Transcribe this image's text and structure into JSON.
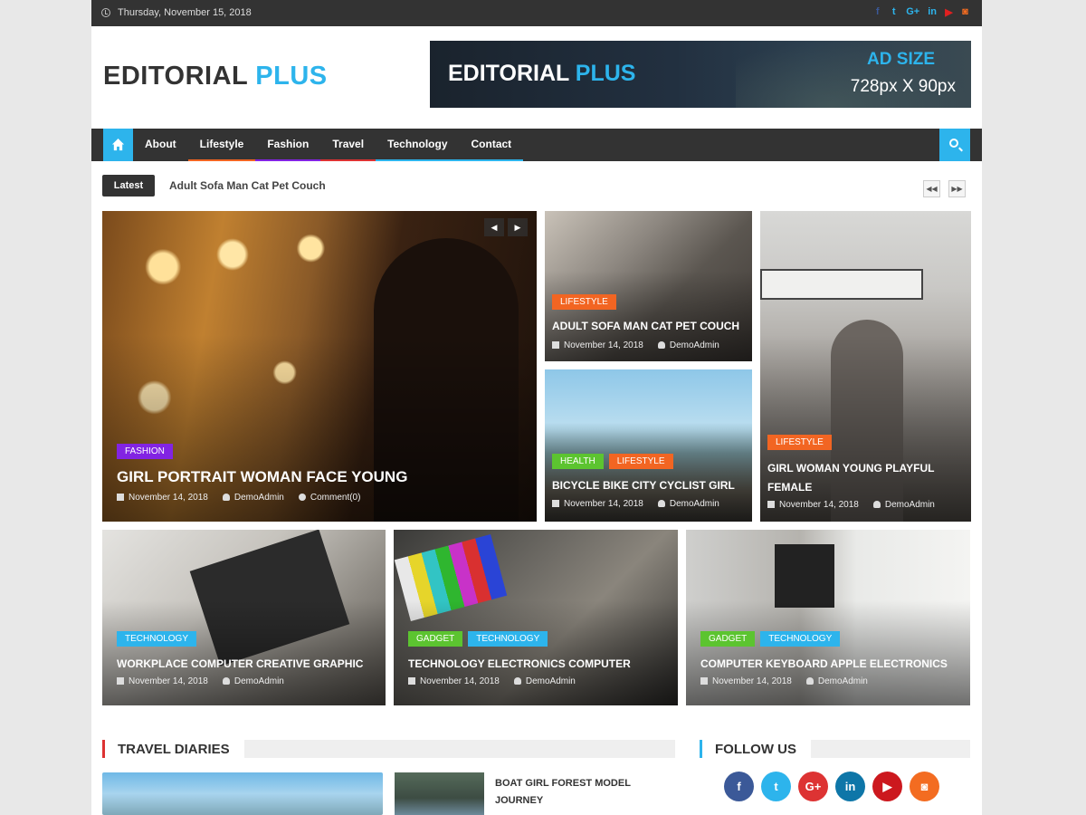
{
  "topbar": {
    "date": "Thursday, November 15, 2018",
    "social_icons": [
      {
        "icon": "facebook-icon",
        "glyph": "f",
        "color": "#3b5998"
      },
      {
        "icon": "twitter-icon",
        "glyph": "t",
        "color": "#2db4ec"
      },
      {
        "icon": "google-plus-icon",
        "glyph": "G+",
        "color": "#2db4ec"
      },
      {
        "icon": "linkedin-icon",
        "glyph": "in",
        "color": "#2db4ec"
      },
      {
        "icon": "youtube-icon",
        "glyph": "▶",
        "color": "#e02020"
      },
      {
        "icon": "instagram-icon",
        "glyph": "◙",
        "color": "#f36c21"
      }
    ]
  },
  "header": {
    "logo_main": "EDITORIAL",
    "logo_accent": "PLUS",
    "ad": {
      "logo_main": "EDITORIAL",
      "logo_accent": "PLUS",
      "size_label": "AD SIZE",
      "dimensions": "728px X 90px"
    }
  },
  "nav": {
    "items": [
      {
        "label": "About",
        "underline": ""
      },
      {
        "label": "Lifestyle",
        "underline": "#f26522"
      },
      {
        "label": "Fashion",
        "underline": "#8224e3"
      },
      {
        "label": "Travel",
        "underline": "#dd3333"
      },
      {
        "label": "Technology",
        "underline": "#2db4ec"
      },
      {
        "label": "Contact",
        "underline": "#2db4ec"
      }
    ]
  },
  "ticker": {
    "label": "Latest",
    "headline": "Adult Sofa Man Cat Pet Couch",
    "prev": "◀◀",
    "next": "▶▶"
  },
  "featured": {
    "main": {
      "tags": [
        {
          "label": "FASHION",
          "color": "#8224e3"
        }
      ],
      "title": "GIRL PORTRAIT WOMAN FACE YOUNG",
      "date": "November 14, 2018",
      "author": "DemoAdmin",
      "comments": "Comment(0)",
      "prev": "◀",
      "next": "▶"
    },
    "side_top": {
      "tags": [
        {
          "label": "LIFESTYLE",
          "color": "#f26522"
        }
      ],
      "title": "ADULT SOFA MAN CAT PET COUCH",
      "date": "November 14, 2018",
      "author": "DemoAdmin"
    },
    "side_bottom": {
      "tags": [
        {
          "label": "HEALTH",
          "color": "#5cc430"
        },
        {
          "label": "LIFESTYLE",
          "color": "#f26522"
        }
      ],
      "title": "BICYCLE BIKE CITY CYCLIST GIRL",
      "date": "November 14, 2018",
      "author": "DemoAdmin"
    },
    "right": {
      "tags": [
        {
          "label": "LIFESTYLE",
          "color": "#f26522"
        }
      ],
      "title": "GIRL WOMAN YOUNG PLAYFUL FEMALE",
      "date": "November 14, 2018",
      "author": "DemoAdmin"
    }
  },
  "row": [
    {
      "tags": [
        {
          "label": "TECHNOLOGY",
          "color": "#2db4ec"
        }
      ],
      "title": "WORKPLACE COMPUTER CREATIVE GRAPHIC",
      "date": "November 14, 2018",
      "author": "DemoAdmin"
    },
    {
      "tags": [
        {
          "label": "GADGET",
          "color": "#5cc430"
        },
        {
          "label": "TECHNOLOGY",
          "color": "#2db4ec"
        }
      ],
      "title": "TECHNOLOGY ELECTRONICS COMPUTER",
      "date": "November 14, 2018",
      "author": "DemoAdmin"
    },
    {
      "tags": [
        {
          "label": "GADGET",
          "color": "#5cc430"
        },
        {
          "label": "TECHNOLOGY",
          "color": "#2db4ec"
        }
      ],
      "title": "COMPUTER KEYBOARD APPLE ELECTRONICS",
      "date": "November 14, 2018",
      "author": "DemoAdmin"
    }
  ],
  "travel": {
    "heading": "TRAVEL DIARIES",
    "accent": "#dd3333",
    "side_title": "BOAT GIRL FOREST MODEL JOURNEY"
  },
  "follow": {
    "heading": "FOLLOW US",
    "accent": "#2db4ec",
    "buttons": [
      {
        "icon": "facebook-icon",
        "glyph": "f",
        "color": "#3b5998"
      },
      {
        "icon": "twitter-icon",
        "glyph": "t",
        "color": "#2db4ec"
      },
      {
        "icon": "google-plus-icon",
        "glyph": "G+",
        "color": "#dd3333"
      },
      {
        "icon": "linkedin-icon",
        "glyph": "in",
        "color": "#0e76a8"
      },
      {
        "icon": "youtube-icon",
        "glyph": "▶",
        "color": "#cc181e"
      },
      {
        "icon": "instagram-icon",
        "glyph": "◙",
        "color": "#f36c21"
      }
    ]
  }
}
